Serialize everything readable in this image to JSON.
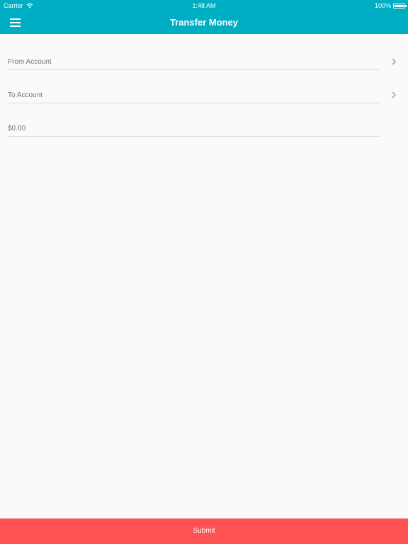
{
  "status_bar": {
    "carrier": "Carrier",
    "time": "1:48 AM",
    "battery_percent": "100%",
    "battery_level": 1.0
  },
  "nav": {
    "title": "Transfer Money"
  },
  "form": {
    "from_account_placeholder": "From Account",
    "to_account_placeholder": "To Account",
    "amount_placeholder": "$0.00"
  },
  "footer": {
    "submit_label": "Submit"
  },
  "colors": {
    "header": "#00aec4",
    "submit": "#ff5252",
    "background": "#fafafa"
  },
  "icons": [
    "wifi-icon",
    "battery-icon",
    "menu-icon",
    "chevron-right-icon"
  ]
}
